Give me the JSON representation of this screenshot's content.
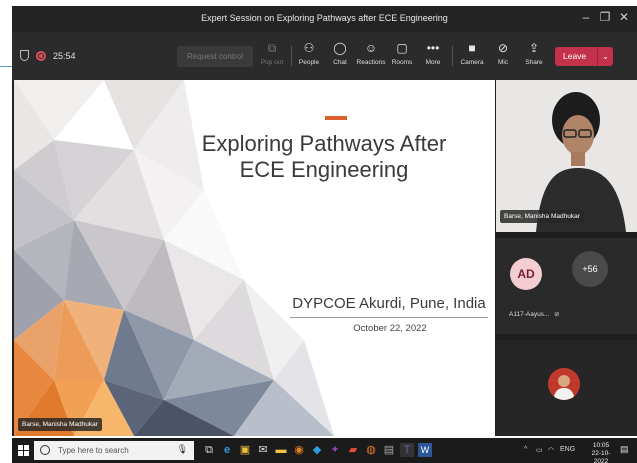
{
  "window": {
    "title": "Expert Session on Exploring Pathways after ECE Engineering",
    "minimize": "–",
    "maximize": "❐",
    "close": "✕"
  },
  "toolbar": {
    "timer": "25:54",
    "request_control": "Request control",
    "popout": "Pop out",
    "people": "People",
    "chat": "Chat",
    "reactions": "Reactions",
    "rooms": "Rooms",
    "more": "More",
    "camera": "Camera",
    "mic": "Mic",
    "share": "Share",
    "leave": "Leave"
  },
  "slide": {
    "title_line1": "Exploring Pathways After",
    "title_line2": "ECE Engineering",
    "place": "DYPCOE Akurdi, Pune, India",
    "date": "October 22, 2022",
    "presenter": "Barse, Manisha Madhukar"
  },
  "participants": {
    "camera_name": "Barse, Manisha Madhukar",
    "avatar_initials": "AD",
    "avatar_name": "A117-Aayus...",
    "more_count": "+56"
  },
  "taskbar": {
    "search_placeholder": "Type here to search",
    "lang": "ENG",
    "time": "10:05",
    "date": "22-10-2022"
  },
  "colors": {
    "leave": "#c4314b",
    "accent": "#d9622b",
    "avatar_bg": "#f3cdd2"
  }
}
